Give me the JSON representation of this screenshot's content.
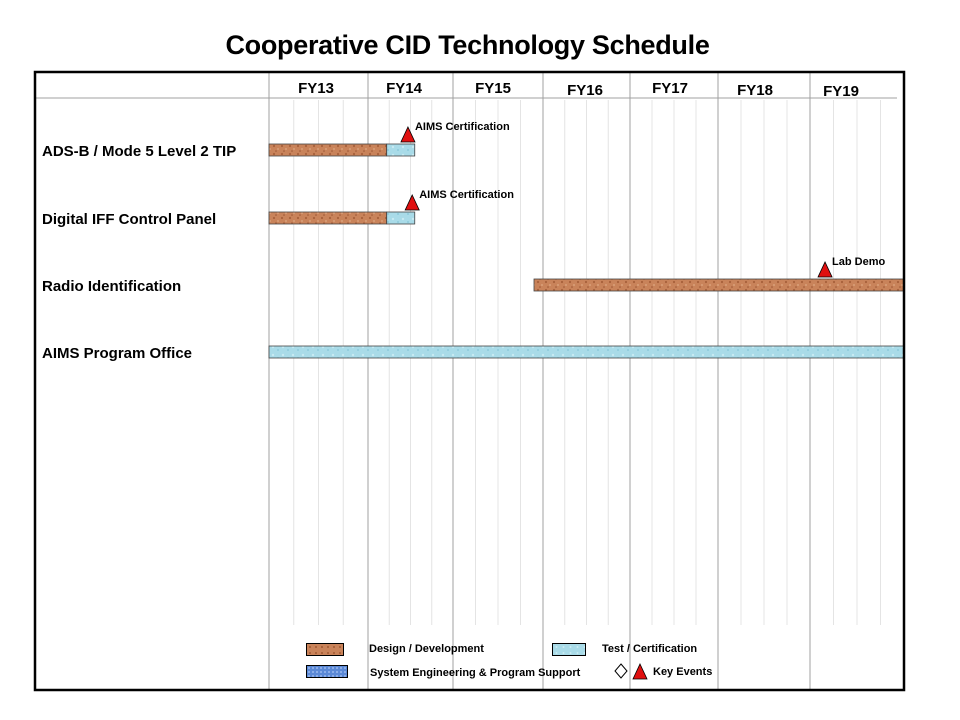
{
  "page": {
    "title": "Cooperative CID Technology Schedule"
  },
  "colors": {
    "design": "#c9835a",
    "test": "#a9dbe8",
    "sys_eng": "#5b89d6",
    "event": "#e01010",
    "frame": "#000000"
  },
  "chart_data": {
    "type": "gantt",
    "title": "Cooperative CID Technology Schedule",
    "fiscal_years": [
      "FY13",
      "FY14",
      "FY15",
      "FY16",
      "FY17",
      "FY18",
      "FY19"
    ],
    "rows": [
      {
        "label": "ADS-B / Mode 5 Level 2 TIP",
        "bars": [
          {
            "type": "design",
            "start": 2013.0,
            "end": 2014.22
          },
          {
            "type": "test",
            "start": 2014.22,
            "end": 2014.55
          }
        ],
        "events": [
          {
            "type": "key",
            "at": 2014.47,
            "label": "AIMS Certification"
          }
        ]
      },
      {
        "label": "Digital IFF Control Panel",
        "bars": [
          {
            "type": "design",
            "start": 2013.0,
            "end": 2014.22
          },
          {
            "type": "test",
            "start": 2014.22,
            "end": 2014.55
          }
        ],
        "events": [
          {
            "type": "key",
            "at": 2014.52,
            "label": "AIMS Certification"
          }
        ]
      },
      {
        "label": "Radio Identification",
        "bars": [
          {
            "type": "design",
            "start": 2015.9,
            "end": 2020.0
          }
        ],
        "events": [
          {
            "type": "key",
            "at": 2019.16,
            "label": "Lab Demo"
          }
        ]
      },
      {
        "label": "AIMS Program Office",
        "bars": [
          {
            "type": "test",
            "start": 2013.0,
            "end": 2020.0
          }
        ],
        "events": []
      }
    ],
    "legend": {
      "design": "Design / Development",
      "test": "Test / Certification",
      "sys_eng": "System Engineering & Program Support",
      "events": "Key Events"
    }
  }
}
